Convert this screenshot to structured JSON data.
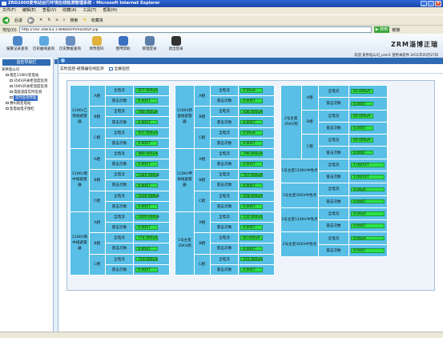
{
  "window": {
    "title": "ZRD2000变电站运行环境在线检测管理系统 - Microsoft Internet Explorer"
  },
  "menu": [
    "文件(F)",
    "编辑(E)",
    "查看(V)",
    "收藏(A)",
    "工具(T)",
    "帮助(H)"
  ],
  "toolbar": {
    "back": "后退",
    "search": "搜索",
    "favorites": "收藏夹"
  },
  "address": {
    "label": "地址(D)",
    "url": "http://192.168.63.1:8080/zrmmo/start.jsp",
    "go": "转到",
    "links": "链接"
  },
  "nav": [
    {
      "label": "报警记录查询",
      "icon": "alarm-log-icon",
      "color": "#4d86c9"
    },
    {
      "label": "历史曲线查询",
      "icon": "history-curve-icon",
      "color": "#5da8e0"
    },
    {
      "label": "历史数据查询",
      "icon": "history-data-icon",
      "color": "#6b8fc0"
    },
    {
      "label": "修改密码",
      "icon": "lock-icon",
      "color": "#e0b23c"
    },
    {
      "label": "使用帮助",
      "icon": "help-icon",
      "color": "#3b6fc0"
    },
    {
      "label": "管理登录",
      "icon": "admin-monitor-icon",
      "color": "#5b7fa8"
    },
    {
      "label": "退出登录",
      "icon": "user-logout-icon",
      "color": "#333333"
    }
  ],
  "brand": "ZRM淄博正瑞",
  "welcome": "欢迎 某供电公司_user1 使用本软件 2011年05月27日",
  "sidebar": {
    "tab": "监控导航栏",
    "tree": [
      {
        "label": "某供电公司",
        "level": 0
      },
      {
        "label": "南区110KV变电站",
        "level": 1
      },
      {
        "label": "35KV开关柜温度监测",
        "level": 2
      },
      {
        "label": "10KV开关柜温度监测",
        "level": 2
      },
      {
        "label": "电缆温度实时监测",
        "level": 2
      },
      {
        "label": "实时监测界面",
        "level": 2,
        "selected": true
      },
      {
        "label": "惠州南变电站",
        "level": 1
      },
      {
        "label": "变电站电子围栏",
        "level": 1
      }
    ]
  },
  "main": {
    "path": "实时监控-避雷器在线监测",
    "fullscreen": "全屏监控"
  },
  "labels": {
    "total": "全电流",
    "count": "雷击次数"
  },
  "columns": [
    {
      "groups": [
        {
          "name": "110KV乙母线避雷器",
          "phases": [
            {
              "phase": "A相",
              "current": "657.000uA",
              "count": "0.00ST"
            },
            {
              "phase": "B相",
              "current": "780.000uA",
              "count": "0.00ST"
            },
            {
              "phase": "C相",
              "current": "937.000uA",
              "count": "0.00ST"
            }
          ]
        },
        {
          "name": "110KV南中线避雷器",
          "phases": [
            {
              "phase": "A相",
              "current": "980.000uA",
              "count": "0.00ST"
            },
            {
              "phase": "B相",
              "current": "1340.000uA",
              "count": "0.00ST"
            },
            {
              "phase": "C相",
              "current": "1030.000uA",
              "count": "0.00ST"
            }
          ]
        },
        {
          "name": "110KV南中线避雷器",
          "phases": [
            {
              "phase": "A相",
              "current": "1000.000uA",
              "count": "0.00ST"
            },
            {
              "phase": "B相",
              "current": "774.000uA",
              "count": "0.00ST"
            },
            {
              "phase": "C相",
              "current": "719.000uA",
              "count": "0.00ST"
            }
          ]
        }
      ]
    },
    {
      "groups": [
        {
          "name": "110KV新里线避雷器",
          "phases": [
            {
              "phase": "A相",
              "current": "0.00uA",
              "count": "0.00ST"
            },
            {
              "phase": "B相",
              "current": "436.000uA",
              "count": "0.00ST"
            },
            {
              "phase": "C相",
              "current": "0.00uA",
              "count": "0.00ST"
            }
          ]
        },
        {
          "name": "110KV甲母线避雷器",
          "phases": [
            {
              "phase": "A相",
              "current": "786.000uA",
              "count": "0.00ST"
            },
            {
              "phase": "B相",
              "current": "767.000uA",
              "count": "0.00ST"
            },
            {
              "phase": "C相",
              "current": "528.000uA",
              "count": "0.00ST"
            }
          ]
        },
        {
          "name": "1号主变35KV侧",
          "phases": [
            {
              "phase": "A相",
              "current": "132.000uA",
              "count": "0.00ST"
            },
            {
              "phase": "B相",
              "current": "62.000uA",
              "count": "0.00ST"
            },
            {
              "phase": "C相",
              "current": "215.000uA",
              "count": "0.00ST"
            }
          ]
        }
      ]
    },
    {
      "groups": [
        {
          "name": "2号主变35KV侧",
          "phases": [
            {
              "phase": "A相",
              "current": "63.000uA",
              "count": "0.00ST"
            },
            {
              "phase": "B相",
              "current": "60.000uA",
              "count": "0.00ST"
            },
            {
              "phase": "C相",
              "current": "60.000uA",
              "count": "0.00ST"
            }
          ]
        }
      ],
      "neutral": [
        {
          "name": "1号主变110KV中性点",
          "current": "1.00/1ST",
          "count": "1.00/1ST"
        },
        {
          "name": "1号主变35KV中性点",
          "current": "0.00uA",
          "count": "0.00ST"
        },
        {
          "name": "2号主变110KV中性点",
          "current": "0.00uA",
          "count": "0.00ST"
        },
        {
          "name": "2号主变35KV中性点",
          "current": "0.00uA",
          "count": "0.00ST"
        }
      ]
    }
  ]
}
